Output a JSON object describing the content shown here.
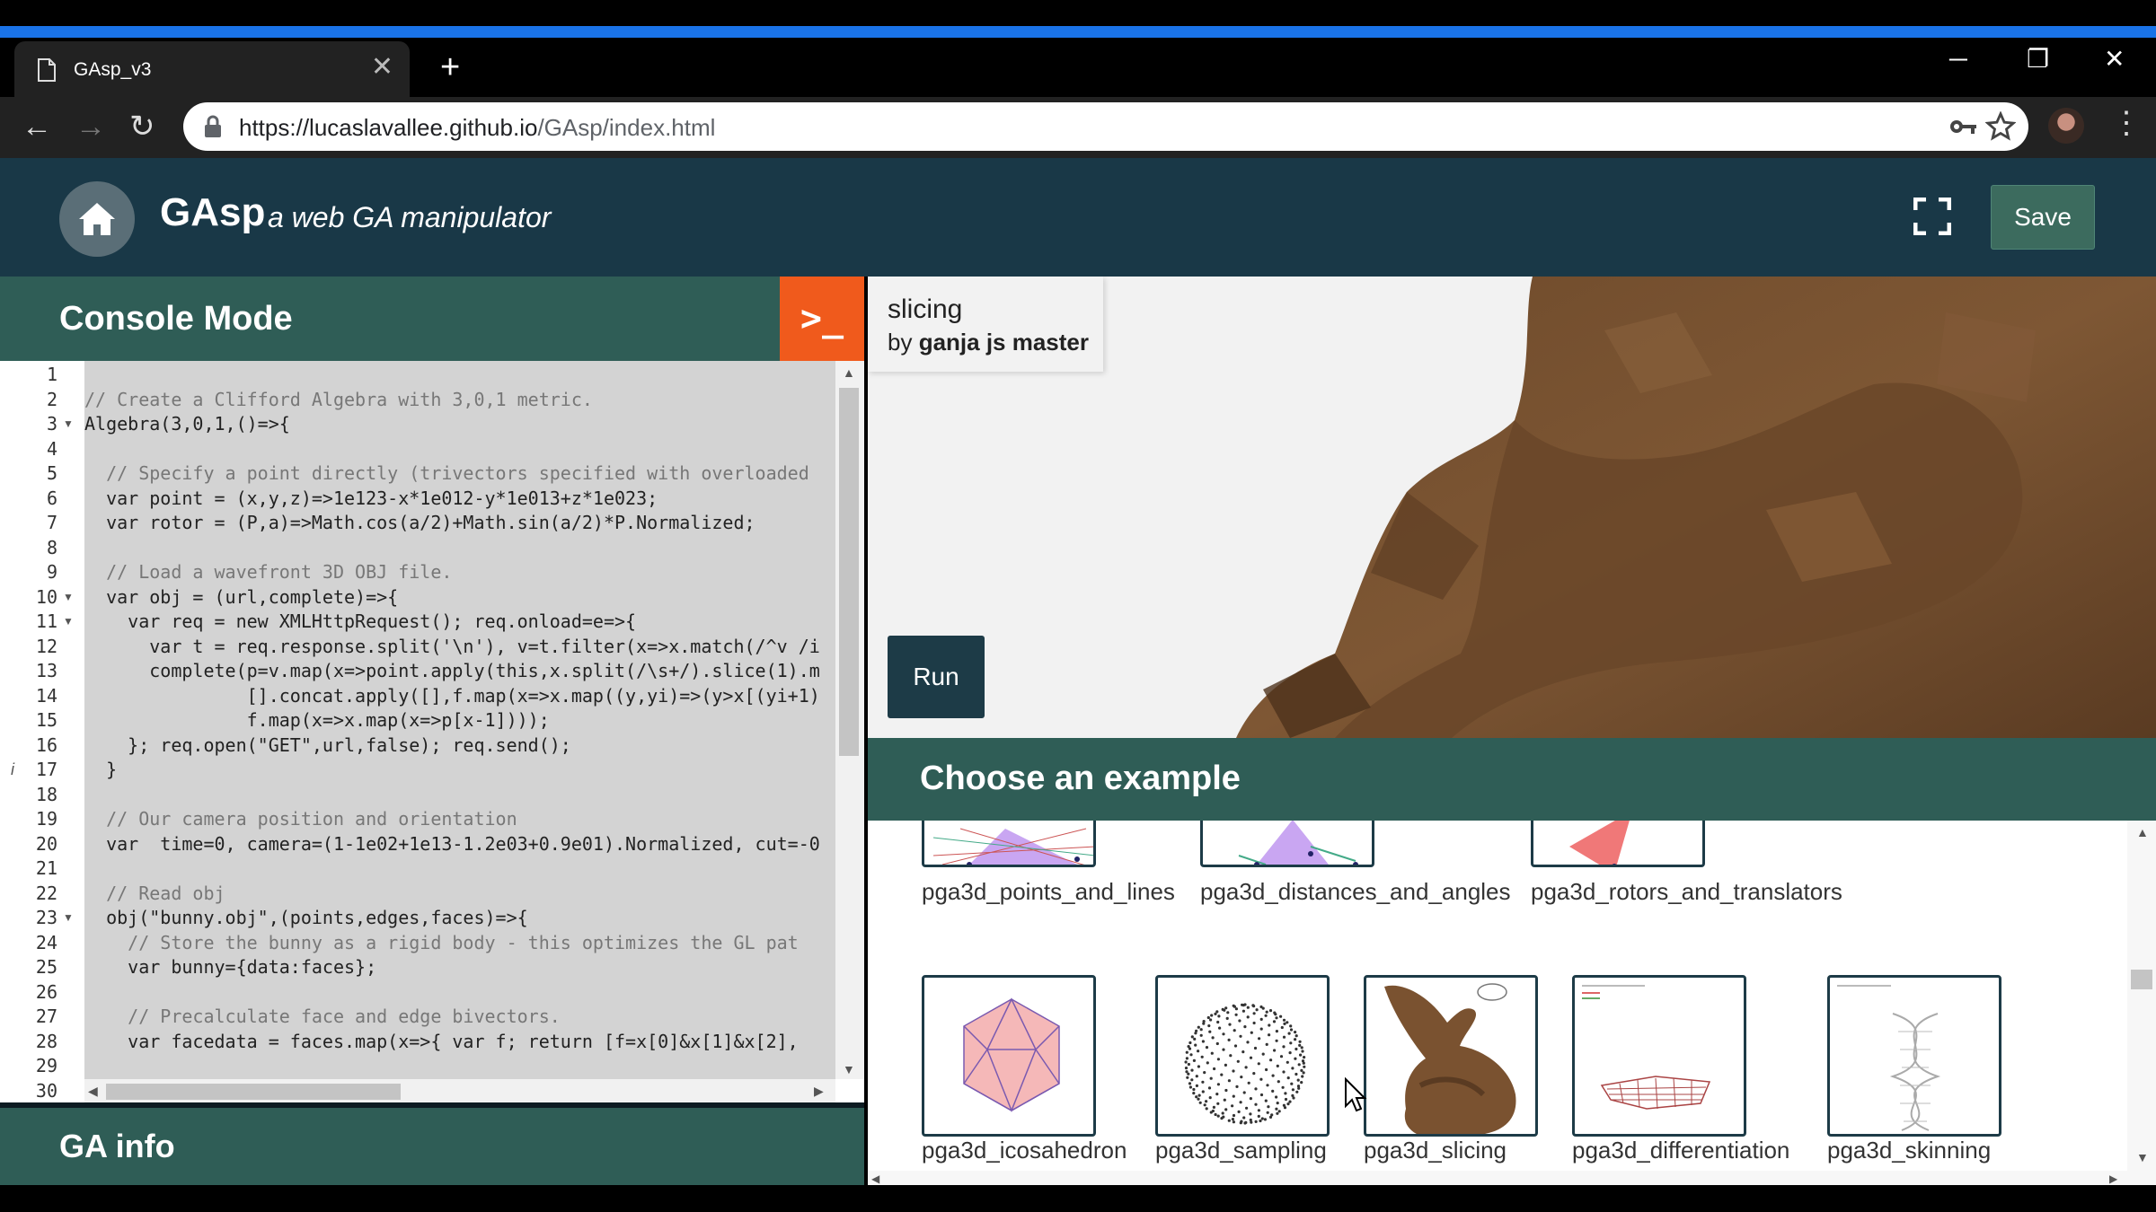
{
  "browser": {
    "tab_title": "GAsp_v3",
    "tab_close": "✕",
    "new_tab": "+",
    "url_host": "https://lucaslavallee.github.io",
    "url_path": "/GAsp/index.html",
    "window_controls": {
      "minimize": "─",
      "restore": "❐",
      "close": "✕"
    },
    "nav": {
      "back": "←",
      "forward": "→",
      "reload": "↻"
    },
    "icons": [
      "page-icon",
      "lock-icon",
      "key-icon",
      "star-icon",
      "profile-avatar",
      "menu-dots-icon"
    ]
  },
  "header": {
    "brand": "GAsp",
    "tagline": "a web GA manipulator",
    "save_label": "Save"
  },
  "console": {
    "title": "Console Mode",
    "toggle_glyph": ">_",
    "line_numbers": [
      "1",
      "2",
      "3",
      "4",
      "5",
      "6",
      "7",
      "8",
      "9",
      "10",
      "11",
      "12",
      "13",
      "14",
      "15",
      "16",
      "17",
      "18",
      "19",
      "20",
      "21",
      "22",
      "23",
      "24",
      "25",
      "26",
      "27",
      "28",
      "29",
      "30"
    ],
    "code_lines": [
      "",
      "// Create a Clifford Algebra with 3,0,1 metric.",
      "Algebra(3,0,1,()=>{",
      "",
      "  // Specify a point directly (trivectors specified with overloaded",
      "  var point = (x,y,z)=>1e123-x*1e012-y*1e013+z*1e023;",
      "  var rotor = (P,a)=>Math.cos(a/2)+Math.sin(a/2)*P.Normalized;",
      "",
      "  // Load a wavefront 3D OBJ file.",
      "  var obj = (url,complete)=>{",
      "    var req = new XMLHttpRequest(); req.onload=e=>{",
      "      var t = req.response.split('\\n'), v=t.filter(x=>x.match(/^v /i",
      "      complete(p=v.map(x=>point.apply(this,x.split(/\\s+/).slice(1).m",
      "               [].concat.apply([],f.map(x=>x.map((y,yi)=>(y>x[(yi+1)",
      "               f.map(x=>x.map(x=>p[x-1])));",
      "    }; req.open(\"GET\",url,false); req.send();",
      "  }",
      "",
      "  // Our camera position and orientation",
      "  var  time=0, camera=(1-1e02+1e13-1.2e03+0.9e01).Normalized, cut=-0",
      "",
      "  // Read obj",
      "  obj(\"bunny.obj\",(points,edges,faces)=>{",
      "    // Store the bunny as a rigid body - this optimizes the GL pat",
      "    var bunny={data:faces};",
      "",
      "    // Precalculate face and edge bivectors.",
      "    var facedata = faces.map(x=>{ var f; return [f=x[0]&x[1]&x[2],",
      "",
      ""
    ]
  },
  "ga_info": {
    "title": "GA info"
  },
  "viewer": {
    "example_title": "slicing",
    "author_prefix": "by ",
    "author": "ganja js master",
    "run_label": "Run"
  },
  "gallery": {
    "title": "Choose an example",
    "row1": [
      {
        "label": "pga3d_points_and_lines"
      },
      {
        "label": "pga3d_distances_and_angles"
      },
      {
        "label": "pga3d_rotors_and_translators"
      }
    ],
    "row2": [
      {
        "label": "pga3d_icosahedron"
      },
      {
        "label": "pga3d_sampling"
      },
      {
        "label": "pga3d_slicing"
      },
      {
        "label": "pga3d_differentiation"
      },
      {
        "label": "pga3d_skinning"
      }
    ]
  },
  "colors": {
    "header_bg": "#193847",
    "panel_head": "#2f5d56",
    "console_accent": "#f05a1c",
    "run_bg": "#1d3b47",
    "save_bg": "#3c6b5e",
    "bunny": "#7a5230"
  }
}
